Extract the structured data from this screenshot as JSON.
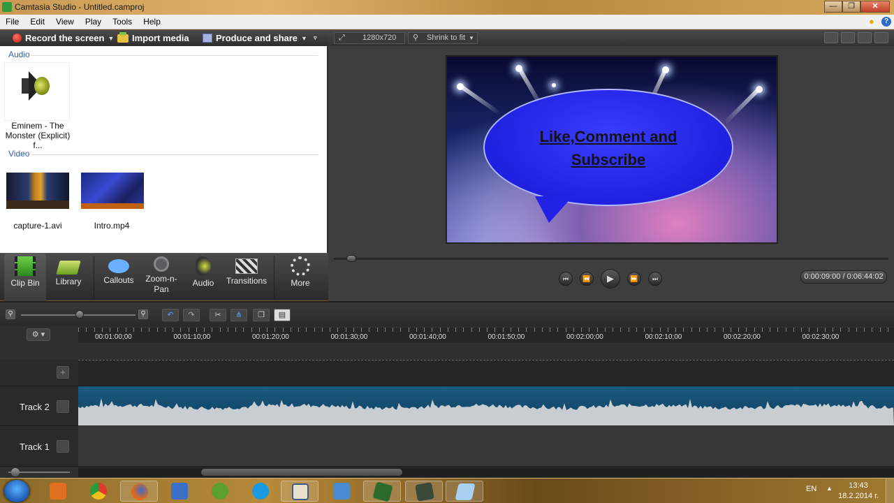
{
  "window": {
    "title": "Camtasia Studio - Untitled.camproj",
    "min_glyph": "—",
    "max_glyph": "❐",
    "close_glyph": "✕"
  },
  "menu": [
    "File",
    "Edit",
    "View",
    "Play",
    "Tools",
    "Help"
  ],
  "left_toolbar": {
    "record_label": "Record the screen",
    "import_label": "Import media",
    "produce_label": "Produce and share"
  },
  "clip_bin": {
    "audio_section": "Audio",
    "video_section": "Video",
    "audio_item_line1": "Eminem - The",
    "audio_item_line2": "Monster (Explicit) f...",
    "video_items": [
      "capture-1.avi",
      "Intro.mp4"
    ]
  },
  "tool_tabs": [
    "Clip Bin",
    "Library",
    "Callouts",
    "Zoom-n-Pan",
    "Audio",
    "Transitions",
    "More"
  ],
  "preview": {
    "dimensions": "1280x720",
    "zoom_mode": "Shrink to fit",
    "callout_line1": "Like,Comment and",
    "callout_line2": "Subscribe",
    "timecode": "0:00:09:00 / 0:06:44:02",
    "position_fraction": 0.023
  },
  "timeline": {
    "ruler_labels": [
      "00:01:00;00",
      "00:01:10;00",
      "00:01:20;00",
      "00:01:30;00",
      "00:01:40;00",
      "00:01:50;00",
      "00:02:00;00",
      "00:02:10;00",
      "00:02:20;00",
      "00:02:30;00"
    ],
    "tracks": [
      "Track 2",
      "Track 1"
    ],
    "add_track_glyph": "+",
    "gear_glyph": "⚙ ▾"
  },
  "taskbar": {
    "lang": "EN",
    "time": "13:43",
    "date": "18.2.2014 г."
  },
  "colors": {
    "accent_blue": "#2f5fa8",
    "audio_clip": "#1c5a80",
    "waveform": "#c8cdd2"
  }
}
